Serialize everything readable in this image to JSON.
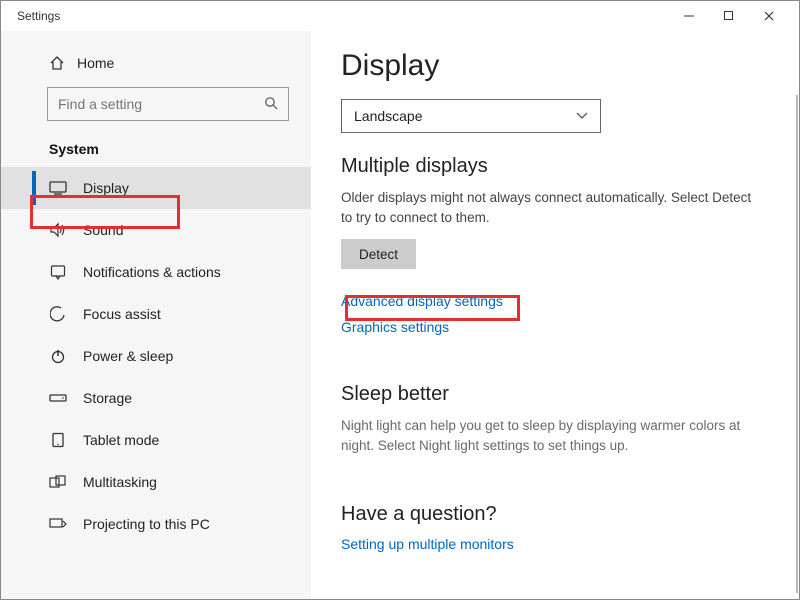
{
  "window": {
    "title": "Settings"
  },
  "sidebar": {
    "home": "Home",
    "search_placeholder": "Find a setting",
    "category": "System",
    "items": [
      {
        "icon": "display",
        "label": "Display",
        "selected": true
      },
      {
        "icon": "sound",
        "label": "Sound"
      },
      {
        "icon": "notifications",
        "label": "Notifications & actions"
      },
      {
        "icon": "focus",
        "label": "Focus assist"
      },
      {
        "icon": "power",
        "label": "Power & sleep"
      },
      {
        "icon": "storage",
        "label": "Storage"
      },
      {
        "icon": "tablet",
        "label": "Tablet mode"
      },
      {
        "icon": "multitask",
        "label": "Multitasking"
      },
      {
        "icon": "project",
        "label": "Projecting to this PC"
      }
    ]
  },
  "main": {
    "heading": "Display",
    "orientation_value": "Landscape",
    "multi_heading": "Multiple displays",
    "multi_desc": "Older displays might not always connect automatically. Select Detect to try to connect to them.",
    "detect_label": "Detect",
    "adv_link": "Advanced display settings",
    "gfx_link": "Graphics settings",
    "sleep_heading": "Sleep better",
    "sleep_desc": "Night light can help you get to sleep by displaying warmer colors at night. Select Night light settings to set things up.",
    "question_heading": "Have a question?",
    "question_link": "Setting up multiple monitors"
  }
}
